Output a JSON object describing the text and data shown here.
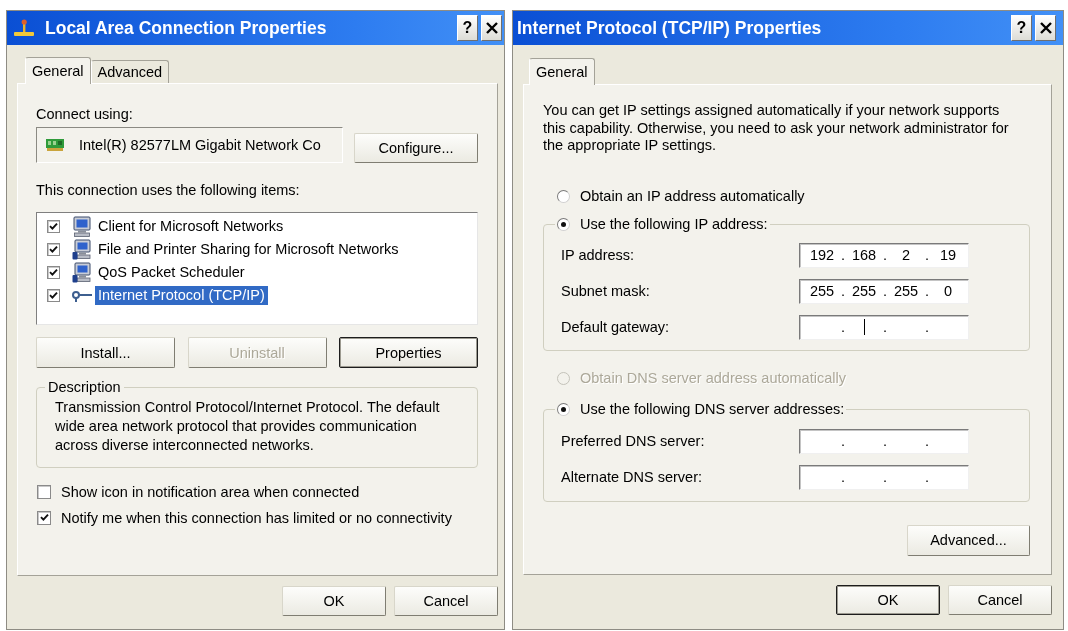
{
  "lan_dialog": {
    "title": "Local Area Connection Properties",
    "help_button": "?",
    "tabs": [
      {
        "label": "General",
        "selected": true
      },
      {
        "label": "Advanced",
        "selected": false
      }
    ],
    "connect_using_label": "Connect using:",
    "adapter": "Intel(R) 82577LM Gigabit Network Co",
    "configure_button": "Configure...",
    "items_label": "This connection uses the following items:",
    "items": [
      {
        "kind": "client",
        "label": "Client for Microsoft Networks",
        "checked": true,
        "selected": false
      },
      {
        "kind": "service",
        "label": "File and Printer Sharing for Microsoft Networks",
        "checked": true,
        "selected": false
      },
      {
        "kind": "service",
        "label": "QoS Packet Scheduler",
        "checked": true,
        "selected": false
      },
      {
        "kind": "protocol",
        "label": "Internet Protocol (TCP/IP)",
        "checked": true,
        "selected": true
      }
    ],
    "item_buttons": [
      {
        "label": "Install...",
        "disabled": false,
        "default": false
      },
      {
        "label": "Uninstall",
        "disabled": true,
        "default": false
      },
      {
        "label": "Properties",
        "disabled": false,
        "default": true
      }
    ],
    "description": {
      "legend": "Description",
      "text": "Transmission Control Protocol/Internet Protocol. The default wide area network protocol that provides communication across diverse interconnected networks."
    },
    "options": [
      {
        "label": "Show icon in notification area when connected",
        "checked": false
      },
      {
        "label": "Notify me when this connection has limited or no connectivity",
        "checked": true
      }
    ],
    "footer_buttons": [
      {
        "label": "OK",
        "default": false
      },
      {
        "label": "Cancel",
        "default": false
      }
    ]
  },
  "tcpip_dialog": {
    "title": "Internet Protocol (TCP/IP) Properties",
    "help_button": "?",
    "tabs": [
      {
        "label": "General",
        "selected": true
      }
    ],
    "intro": "You can get IP settings assigned automatically if your network supports this capability. Otherwise, you need to ask your network administrator for the appropriate IP settings.",
    "ip_choice": [
      {
        "label": "Obtain an IP address automatically",
        "selected": false,
        "disabled": false
      },
      {
        "label": "Use the following IP address:",
        "selected": true,
        "disabled": false
      }
    ],
    "ip_fields": [
      {
        "label": "IP address:",
        "octets": [
          "192",
          "168",
          "2",
          "19"
        ],
        "separators": [
          ".",
          ".",
          "."
        ],
        "caret": false
      },
      {
        "label": "Subnet mask:",
        "octets": [
          "255",
          "255",
          "255",
          "0"
        ],
        "separators": [
          ".",
          ".",
          "."
        ],
        "caret": false
      },
      {
        "label": "Default gateway:",
        "separators": [
          ".",
          ".",
          "."
        ],
        "caret": true
      }
    ],
    "dns_choice": [
      {
        "label": "Obtain DNS server address automatically",
        "selected": false,
        "disabled": true
      },
      {
        "label": "Use the following DNS server addresses:",
        "selected": true,
        "disabled": false
      }
    ],
    "dns_fields": [
      {
        "label": "Preferred DNS server:",
        "separators": [
          ".",
          ".",
          "."
        ],
        "caret": false
      },
      {
        "label": "Alternate DNS server:",
        "separators": [
          ".",
          ".",
          "."
        ],
        "caret": false
      }
    ],
    "advanced_button": "Advanced...",
    "footer_buttons": [
      {
        "label": "OK",
        "default": true
      },
      {
        "label": "Cancel",
        "default": false
      }
    ]
  }
}
